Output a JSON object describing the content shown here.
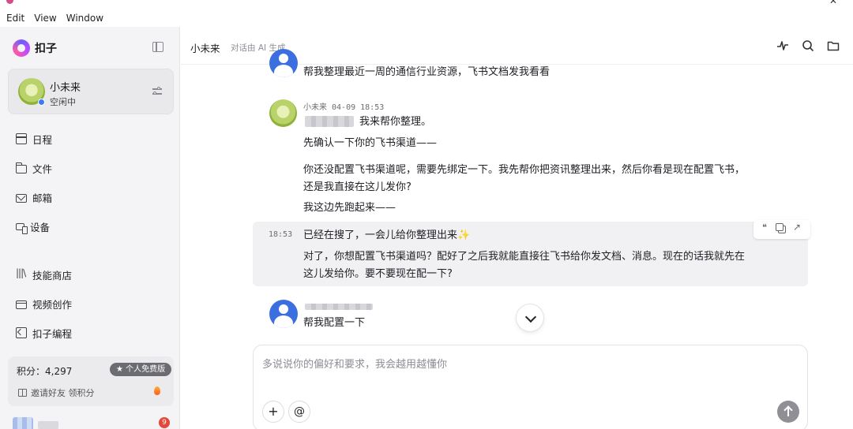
{
  "menubar": {
    "items": [
      "Edit",
      "View",
      "Window"
    ]
  },
  "sidebar": {
    "brand": "扣子",
    "agent": {
      "name": "小未来",
      "status": "空闲中"
    },
    "nav": [
      {
        "label": "日程",
        "icon": "calendar-icon"
      },
      {
        "label": "文件",
        "icon": "folder-icon"
      },
      {
        "label": "邮箱",
        "icon": "mail-icon"
      },
      {
        "label": "设备",
        "icon": "device-icon"
      },
      {
        "label": "技能商店",
        "icon": "library-icon"
      },
      {
        "label": "视频创作",
        "icon": "video-icon"
      },
      {
        "label": "扣子编程",
        "icon": "code-icon"
      }
    ],
    "points": {
      "label": "积分：4,297",
      "badge": "★ 个人免费版",
      "invite": "邀请好友 领积分"
    },
    "notification_count": "9"
  },
  "chat": {
    "title": "小未来",
    "subtitle": "对话由 AI 生成",
    "messages": {
      "user_1": "帮我整理最近一周的通信行业资源，飞书文档发我看看",
      "ai_meta": "小未来 04-09 18:53",
      "ai_line1": "我来帮你整理。",
      "ai_line2": "先确认一下你的飞书渠道——",
      "ai_line3": "你还没配置飞书渠道呢，需要先绑定一下。我先帮你把资讯整理出来，然后你看是现在配置飞书，",
      "ai_line4": "还是我直接在这儿发你?",
      "ai_line5": "我这边先跑起来——",
      "ai2_time": "18:53",
      "ai2_line1": "已经在搜了，一会儿给你整理出来✨",
      "ai2_line2": "对了，你想配置飞书渠道吗？配好了之后我就能直接往飞书给你发文档、消息。现在的话我就先在",
      "ai2_line3": "这儿发给你。要不要现在配一下?",
      "user_2": "帮我配置一下"
    },
    "composer": {
      "placeholder": "多说说你的偏好和要求，我会越用越懂你",
      "value": ""
    }
  }
}
